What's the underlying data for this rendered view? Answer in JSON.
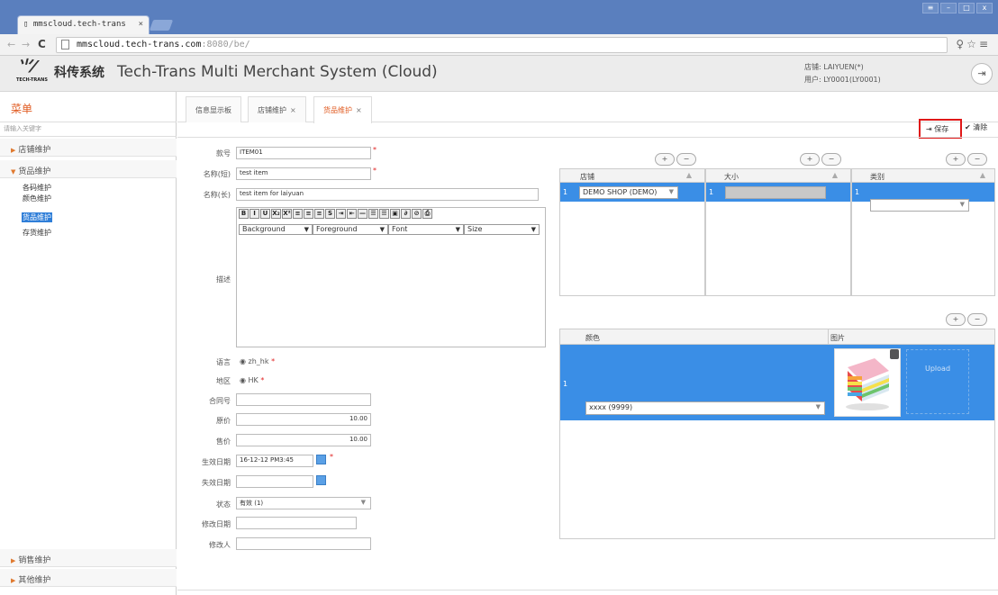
{
  "browser": {
    "tab_title": "mmscloud.tech-trans",
    "tab_close": "×",
    "url_host": "mmscloud.tech-trans.com",
    "url_port_path": ":8080/be/",
    "win_buttons": [
      "≡",
      "–",
      "□",
      "x"
    ],
    "nav_back": "←",
    "nav_forward": "→",
    "nav_reload": "C",
    "right_icons": "♀☆≡"
  },
  "header": {
    "logo_mark": "⺌⁄",
    "logo_sub": "TECH-TRANS",
    "title_cn": "科传系统",
    "title_en": "Tech-Trans Multi Merchant System (Cloud)",
    "shop_line": "店铺: LAIYUEN(*)",
    "user_line": "用户: LY0001(LY0001)",
    "logout_icon": "exit-icon"
  },
  "sidebar": {
    "title": "菜单",
    "search_placeholder": "请输入关键字",
    "groups": [
      {
        "label": "店铺维护",
        "expanded": false
      },
      {
        "label": "货品维护",
        "expanded": true
      },
      {
        "label": "销售维护",
        "expanded": false
      },
      {
        "label": "其他维护",
        "expanded": false
      }
    ],
    "sub_items": [
      "各码维护",
      "颜色维护",
      "货品维护",
      "存货维护"
    ],
    "active_sub": "货品维护"
  },
  "tabs": [
    {
      "label": "信息显示板",
      "closable": false,
      "active": false
    },
    {
      "label": "店铺维护",
      "closable": true,
      "active": false
    },
    {
      "label": "货品维护",
      "closable": true,
      "active": true
    }
  ],
  "toolbar": {
    "save_label": "保存",
    "clear_label": "清除"
  },
  "form": {
    "item_no_label": "款号",
    "item_no_value": "ITEM01",
    "name_short_label": "名称(短)",
    "name_short_value": "test item",
    "name_long_label": "名称(长)",
    "name_long_value": "test item for laiyuan",
    "desc_label": "描述",
    "language_label": "语言",
    "language_value": "zh_hk",
    "region_label": "地区",
    "region_value": "HK",
    "contract_label": "合同号",
    "contract_value": "",
    "orig_price_label": "原价",
    "orig_price_value": "10.00",
    "sell_price_label": "售价",
    "sell_price_value": "10.00",
    "effective_label": "生效日期",
    "effective_value": "16-12-12 PM3:45",
    "expiry_label": "失效日期",
    "expiry_value": "",
    "status_label": "状态",
    "status_value": "有效 (1)",
    "modified_date_label": "修改日期",
    "modified_date_value": "",
    "modified_by_label": "修改人",
    "modified_by_value": ""
  },
  "editor": {
    "buttons": [
      "B",
      "I",
      "U",
      "X₂",
      "X²",
      "≡",
      "≡",
      "≡",
      "S",
      "⇥",
      "⇤",
      "—",
      "☰",
      "☰",
      "▣",
      "∂",
      "⊘",
      "⎙"
    ],
    "selects": [
      "Background",
      "Foreground",
      "Font",
      "Size"
    ]
  },
  "shop_grid": {
    "header": "店铺",
    "row_num": "1",
    "value": "DEMO SHOP (DEMO)",
    "plus": "+",
    "minus": "−"
  },
  "size_grid": {
    "header": "大小",
    "row_num": "1",
    "value": ""
  },
  "category_grid": {
    "header": "类别",
    "row_num": "1",
    "value": ""
  },
  "color_grid": {
    "header_color": "颜色",
    "header_image": "图片",
    "row_num": "1",
    "color_value": "xxxx (9999)",
    "upload_label": "Upload",
    "delete_icon": "trash-icon"
  },
  "sort_arrow": "▲",
  "dropdown_arrow": "▼",
  "calendar_icon": "calendar-icon",
  "radio_mark": "◉"
}
